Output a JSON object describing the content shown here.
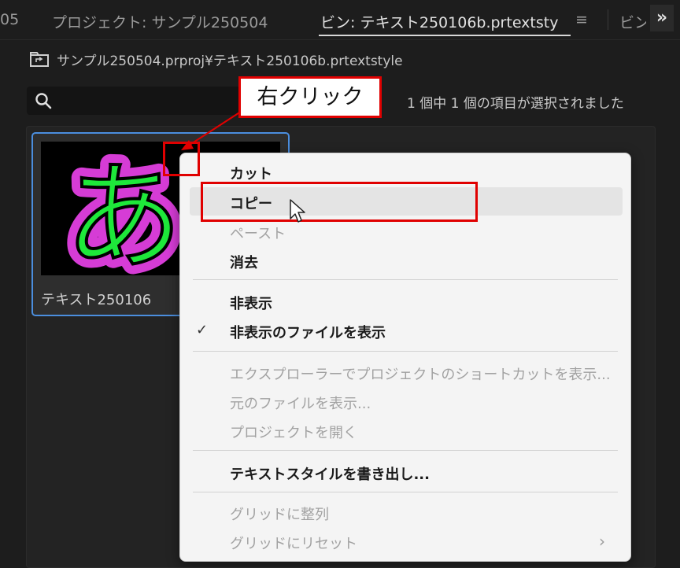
{
  "tabs": [
    {
      "label": "05"
    },
    {
      "label": "プロジェクト: サンプル250504"
    },
    {
      "label": "ビン: テキスト250106b.prtextsty",
      "active": true
    },
    {
      "label": "ビン"
    }
  ],
  "tab_menu_glyph": "≡",
  "overflow_glyph": "»",
  "path": "サンプル250504.prproj¥テキスト250106b.prtextstyle",
  "search": {
    "value": "",
    "placeholder": ""
  },
  "selection_status": "1 個中 1 個の項目が選択されました",
  "thumbnail": {
    "label": "テキスト250106",
    "preview_text": "あ"
  },
  "annotation": {
    "callout": "右クリック"
  },
  "context_menu": {
    "items": [
      {
        "label": "カット",
        "enabled": true
      },
      {
        "label": "コピー",
        "enabled": true,
        "hovered": true
      },
      {
        "label": "ペースト",
        "enabled": false
      },
      {
        "label": "消去",
        "enabled": true
      },
      {
        "label": "非表示",
        "enabled": true
      },
      {
        "label": "非表示のファイルを表示",
        "enabled": true,
        "checked": true
      },
      {
        "label": "エクスプローラーでプロジェクトのショートカットを表示...",
        "enabled": false
      },
      {
        "label": "元のファイルを表示...",
        "enabled": false
      },
      {
        "label": "プロジェクトを開く",
        "enabled": false
      },
      {
        "label": "テキストスタイルを書き出し...",
        "enabled": true
      },
      {
        "label": "グリッドに整列",
        "enabled": false
      },
      {
        "label": "グリッドにリセット",
        "enabled": false,
        "has_submenu": true
      }
    ],
    "check_glyph": "✓",
    "submenu_glyph": "›"
  },
  "colors": {
    "panel_bg": "#1d1d1d",
    "selection_border": "#4b8ede",
    "annotation_red": "#e00000",
    "text_fill": "#1ee83a",
    "text_stroke": "#d63cd6"
  },
  "icons": [
    "bin-folder-icon",
    "search-icon",
    "panel-menu-icon",
    "overflow-icon",
    "check-icon",
    "submenu-arrow-icon",
    "mouse-cursor-icon"
  ]
}
